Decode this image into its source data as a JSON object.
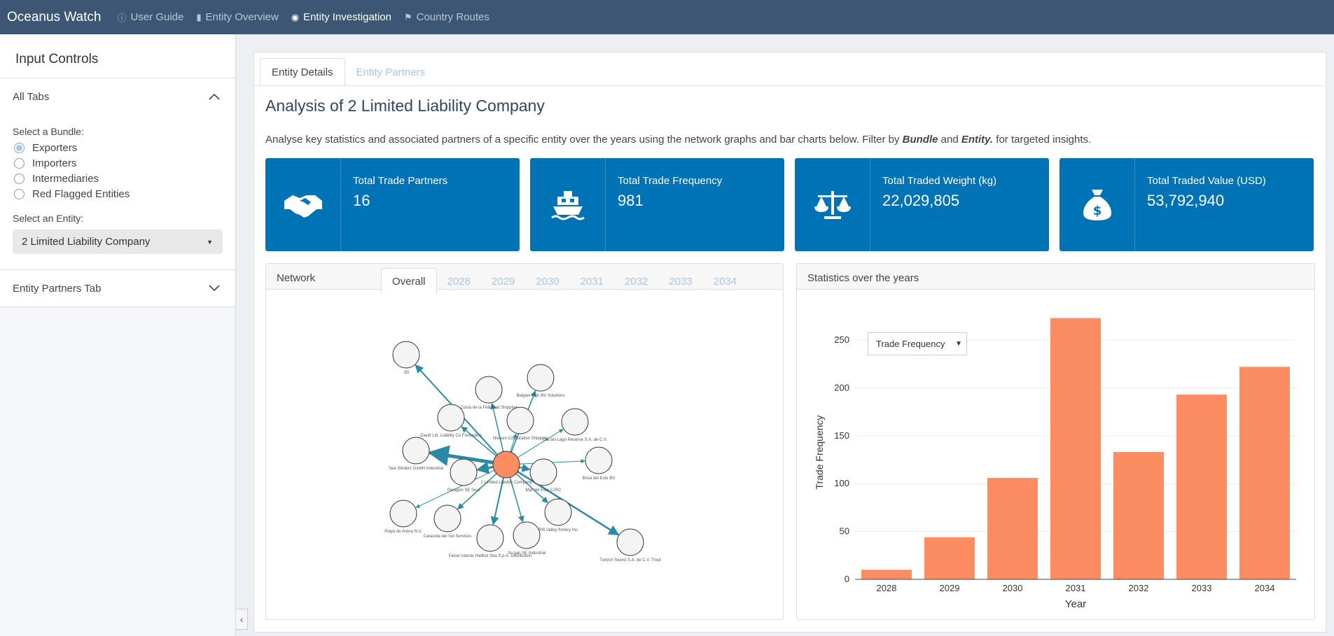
{
  "nav": {
    "brand": "Oceanus Watch",
    "items": [
      {
        "label": "User Guide",
        "icon": "info-circle-icon",
        "active": false
      },
      {
        "label": "Entity Overview",
        "icon": "bar-chart-icon",
        "active": false
      },
      {
        "label": "Entity Investigation",
        "icon": "eye-icon",
        "active": true
      },
      {
        "label": "Country Routes",
        "icon": "flag-icon",
        "active": false
      }
    ]
  },
  "sidebar": {
    "title": "Input Controls",
    "all_tabs": "All Tabs",
    "bundle_label": "Select a Bundle:",
    "bundles": [
      "Exporters",
      "Importers",
      "Intermediaries",
      "Red Flagged Entities"
    ],
    "selected_bundle": "Exporters",
    "entity_label": "Select an Entity:",
    "entity_value": "2 Limited Liability Company",
    "partners_tab": "Entity Partners Tab"
  },
  "main": {
    "tabs": [
      "Entity Details",
      "Entity Partners"
    ],
    "title": "Analysis of 2 Limited Liability Company",
    "desc_pre": "Analyse key statistics and associated partners of a specific entity over the years using the network graphs and bar charts below. Filter by ",
    "desc_b1": "Bundle",
    "desc_mid": " and ",
    "desc_b2": "Entity.",
    "desc_post": " for targeted insights."
  },
  "cards": [
    {
      "title": "Total Trade Partners",
      "value": "16",
      "icon": "handshake-icon"
    },
    {
      "title": "Total Trade Frequency",
      "value": "981",
      "icon": "ship-icon"
    },
    {
      "title": "Total Traded Weight (kg)",
      "value": "22,029,805",
      "icon": "balance-scale-icon"
    },
    {
      "title": "Total Traded Value (USD)",
      "value": "53,792,940",
      "icon": "money-bag-icon"
    }
  ],
  "network": {
    "title": "Network",
    "year_tabs": [
      "Overall",
      "2028",
      "2029",
      "2030",
      "2031",
      "2032",
      "2033",
      "2034"
    ],
    "center": "2 Limited Liability Company",
    "nodes": [
      {
        "label": "-50"
      },
      {
        "label": "Costa de la Felicidad Shipping"
      },
      {
        "label": "Belgian Fish BV Solutions"
      },
      {
        "label": "David Ltd. Liability Co Forwading"
      },
      {
        "label": "Nielsen Corporation Shipping"
      },
      {
        "label": "Ola del Lago Reserve S.A. de C.V."
      },
      {
        "label": "Sea Striders GmbH Industrial"
      },
      {
        "label": "Brisa del Este BV"
      },
      {
        "label": "Paragon SE Seal"
      },
      {
        "label": "Mar del Este CJSC"
      },
      {
        "label": "Playa de Arena N.V."
      },
      {
        "label": "Caracola del Sol Services"
      },
      {
        "label": "Rift Valley fishery Inc"
      },
      {
        "label": "Faroe Islands Halibut Sea S.p.A. Distribution"
      },
      {
        "label": "Yu gan SE Industrial"
      },
      {
        "label": "Turkish Sword S.A. de C.V. Trout"
      }
    ]
  },
  "stats": {
    "title": "Statistics over the years",
    "dropdown": "Trade Frequency"
  },
  "chart_data": {
    "type": "bar",
    "categories": [
      "2028",
      "2029",
      "2030",
      "2031",
      "2032",
      "2033",
      "2034"
    ],
    "values": [
      10,
      44,
      106,
      273,
      133,
      193,
      222
    ],
    "xlabel": "Year",
    "ylabel": "Trade Frequency",
    "yticks": [
      0,
      50,
      100,
      150,
      200,
      250
    ],
    "ylim": [
      0,
      280
    ],
    "bar_color": "#fc8d62"
  }
}
